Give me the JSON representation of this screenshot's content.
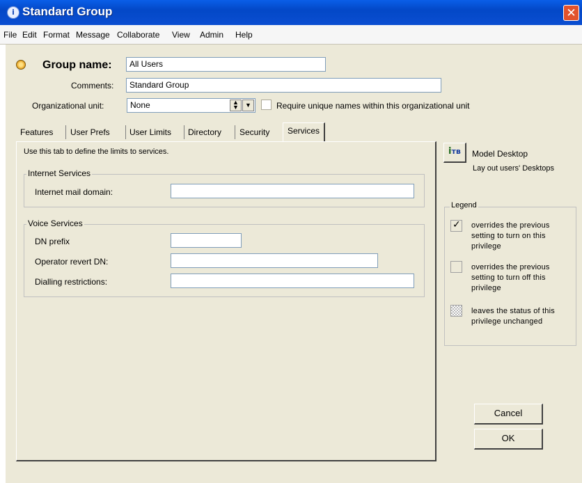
{
  "window": {
    "title": "Standard Group"
  },
  "menu": [
    "File",
    "Edit",
    "Format",
    "Message",
    "Collaborate",
    "View",
    "Admin",
    "Help"
  ],
  "form": {
    "group_name_label": "Group name:",
    "group_name_value": "All Users",
    "comments_label": "Comments:",
    "comments_value": "Standard Group",
    "org_unit_label": "Organizational unit:",
    "org_unit_value": "None",
    "require_unique_label": "Require unique names within this organizational unit"
  },
  "tabs": [
    "Features",
    "User Prefs",
    "User Limits",
    "Directory",
    "Security",
    "Services"
  ],
  "active_tab": "Services",
  "services": {
    "intro": "Use this tab to define the limits to services.",
    "internet_group": "Internet Services",
    "internet_mail_domain_label": "Internet mail domain:",
    "internet_mail_domain_value": "",
    "voice_group": "Voice Services",
    "dn_prefix_label": "DN prefix",
    "dn_prefix_value": "",
    "operator_revert_label": "Operator revert DN:",
    "operator_revert_value": "",
    "dialling_label": "Dialling restrictions:",
    "dialling_value": ""
  },
  "sidebar": {
    "model_desktop_label": "Model Desktop",
    "model_desktop_sub": "Lay out users' Desktops",
    "legend_title": "Legend",
    "legend_1": [
      "overrides the previous",
      "setting to turn on this",
      "privilege"
    ],
    "legend_2": [
      "overrides the previous",
      "setting to turn off this",
      "privilege"
    ],
    "legend_3": [
      "leaves the status of this",
      "privilege unchanged"
    ]
  },
  "buttons": {
    "cancel": "Cancel",
    "ok": "OK"
  },
  "icons": [
    "info-icon",
    "close-icon",
    "group-icon",
    "spinner-arrows-icon",
    "dropdown-arrow-icon",
    "model-desktop-icon",
    "checkmark-icon"
  ]
}
